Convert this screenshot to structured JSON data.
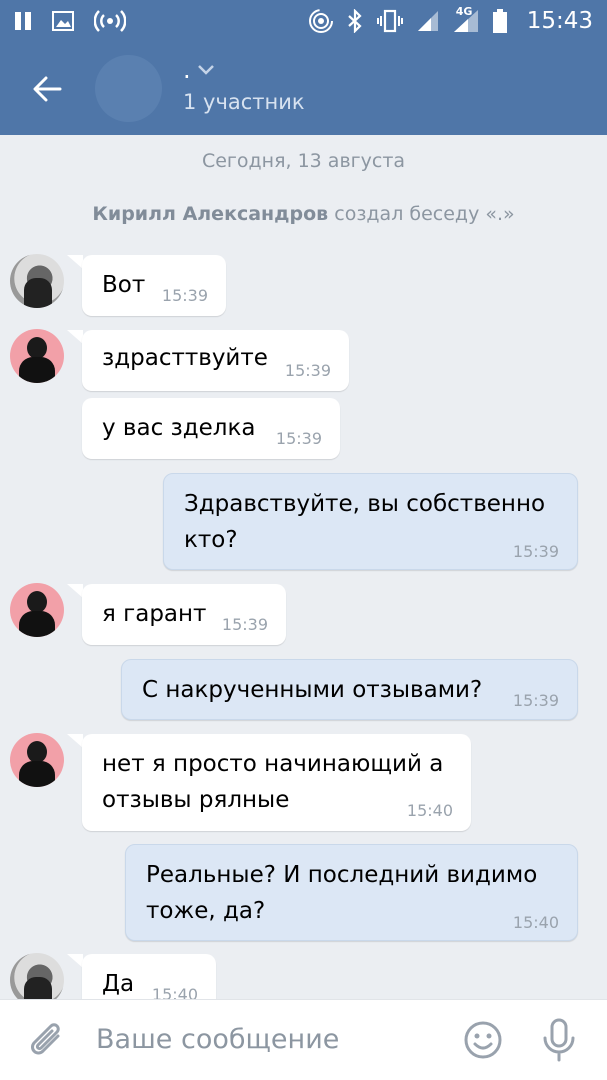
{
  "status_bar": {
    "time": "15:43",
    "network": "4G",
    "icons": [
      "pause-icon",
      "image-icon",
      "broadcast-icon",
      "hotspot-icon",
      "bluetooth-icon",
      "vibrate-icon",
      "signal-icon",
      "signal-4g-icon",
      "battery-icon"
    ]
  },
  "header": {
    "title": ".",
    "subtitle": "1 участник"
  },
  "chat": {
    "date": "Сегодня, 13 августа",
    "system": {
      "author": "Кирилл Александров",
      "action": "создал беседу «.»"
    },
    "messages": [
      {
        "dir": "in",
        "sender": "kirill",
        "text": "Вот",
        "time": "15:39"
      },
      {
        "dir": "in",
        "sender": "guarant",
        "text": "здрасттвуйте",
        "time": "15:39"
      },
      {
        "dir": "in",
        "sender": "guarant",
        "text": "у вас зделка",
        "time": "15:39"
      },
      {
        "dir": "out",
        "text_lines": [
          "Здравствуйте, вы собственно",
          "кто?"
        ],
        "time": "15:39"
      },
      {
        "dir": "in",
        "sender": "guarant",
        "text": "я гарант",
        "time": "15:39"
      },
      {
        "dir": "out",
        "text": "С накрученными отзывами?",
        "time": "15:39"
      },
      {
        "dir": "in",
        "sender": "guarant",
        "text_lines": [
          "нет я просто начинающий а",
          "отзывы рялные"
        ],
        "time": "15:40"
      },
      {
        "dir": "out",
        "text_lines": [
          "Реальные? И последний видимо",
          "тоже, да?"
        ],
        "time": "15:40"
      },
      {
        "dir": "in",
        "sender": "kirill",
        "text": "Да",
        "time": "15:40"
      }
    ]
  },
  "input": {
    "placeholder": "Ваше сообщение"
  },
  "colors": {
    "header": "#4f76a8",
    "background": "#ebeef2",
    "bubble_in": "#ffffff",
    "bubble_out": "#dce7f5"
  }
}
